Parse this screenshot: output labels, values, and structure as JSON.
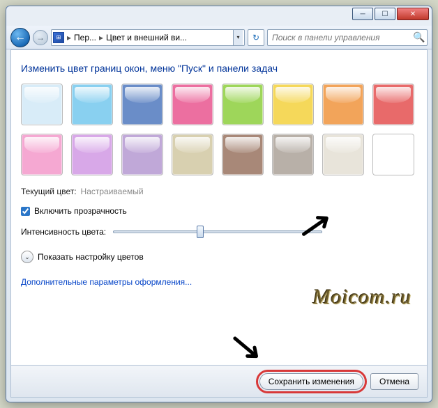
{
  "window": {
    "breadcrumb1": "Пер...",
    "breadcrumb2": "Цвет и внешний ви...",
    "searchPlaceholder": "Поиск в панели управления"
  },
  "page": {
    "heading": "Изменить цвет границ окон, меню \"Пуск\" и панели задач",
    "currentLabel": "Текущий цвет:",
    "currentValue": "Настраиваемый",
    "transparencyLabel": "Включить прозрачность",
    "intensityLabel": "Интенсивность цвета:",
    "showMixerLabel": "Показать настройку цветов",
    "advancedLink": "Дополнительные параметры оформления..."
  },
  "colors": [
    "#d8ecf8",
    "#89d0f0",
    "#6a8dc8",
    "#ec6fa0",
    "#9ed65a",
    "#f5d85a",
    "#f2a45a",
    "#e86a6a",
    "#f5a8d2",
    "#d8a8e8",
    "#c0a8d8",
    "#d8d0b0",
    "#a88878",
    "#b8b0a8",
    "#e8e4da",
    "#ffffff"
  ],
  "footer": {
    "save": "Сохранить изменения",
    "cancel": "Отмена"
  },
  "watermark": "Moicom.ru"
}
